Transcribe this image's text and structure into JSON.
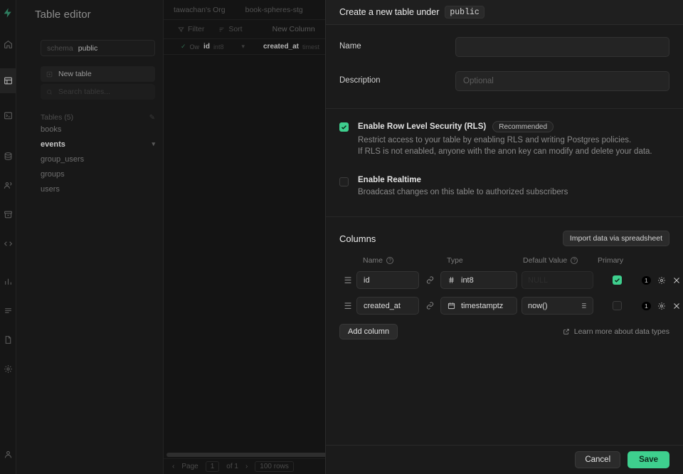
{
  "app": {
    "panel_title": "Table editor",
    "schema_label": "schema",
    "schema_value": "public",
    "new_table_label": "New table",
    "search_placeholder": "Search tables...",
    "tables_header": "Tables (5)",
    "tables": [
      {
        "name": "books",
        "selected": false
      },
      {
        "name": "events",
        "selected": true
      },
      {
        "name": "group_users",
        "selected": false
      },
      {
        "name": "groups",
        "selected": false
      },
      {
        "name": "users",
        "selected": false
      }
    ],
    "breadcrumbs": [
      "tawachan's Org",
      "book-spheres-stg"
    ],
    "toolbar": {
      "filter": "Filter",
      "sort": "Sort",
      "new_column": "New Column"
    },
    "grid_columns": [
      {
        "name": "id",
        "type": "int8"
      },
      {
        "name": "created_at",
        "type": "timest"
      }
    ],
    "footer": {
      "page_label": "Page",
      "page_value": "1",
      "of_label": "of 1",
      "rows_label": "100 rows"
    },
    "rail_icons": [
      "home-icon",
      "table-editor-icon",
      "sql-editor-icon",
      "database-icon",
      "auth-icon",
      "storage-icon",
      "api-icon",
      "reports-icon",
      "logs-icon",
      "docs-icon",
      "settings-icon",
      "account-icon"
    ]
  },
  "modal": {
    "title": "Create a new table under",
    "schema_chip": "public",
    "name": {
      "label": "Name",
      "value": "",
      "placeholder": ""
    },
    "description": {
      "label": "Description",
      "value": "",
      "placeholder": "Optional"
    },
    "options": [
      {
        "id": "rls",
        "title": "Enable Row Level Security (RLS)",
        "badge": "Recommended",
        "checked": true,
        "lines": [
          "Restrict access to your table by enabling RLS and writing Postgres policies.",
          "If RLS is not enabled, anyone with the anon key can modify and delete your data."
        ]
      },
      {
        "id": "realtime",
        "title": "Enable Realtime",
        "badge": "",
        "checked": false,
        "lines": [
          "Broadcast changes on this table to authorized subscribers"
        ]
      }
    ],
    "columns_section": {
      "title": "Columns",
      "import_button": "Import data via spreadsheet",
      "headers": {
        "name": "Name",
        "type": "Type",
        "default_value": "Default Value",
        "primary": "Primary"
      },
      "rows": [
        {
          "name": "id",
          "type": "int8",
          "type_icon": "hash-icon",
          "default_value": "",
          "default_placeholder": "NULL",
          "default_has_picker": false,
          "primary": true,
          "badge_count": "1"
        },
        {
          "name": "created_at",
          "type": "timestamptz",
          "type_icon": "calendar-icon",
          "default_value": "now()",
          "default_placeholder": "",
          "default_has_picker": true,
          "primary": false,
          "badge_count": "1"
        }
      ],
      "add_column": "Add column",
      "learn_more": "Learn more about data types"
    },
    "footer": {
      "cancel": "Cancel",
      "save": "Save"
    }
  },
  "colors": {
    "accent_green": "#3ECF8E",
    "modal_bg": "#1B1B1B",
    "app_bg": "#141414"
  }
}
